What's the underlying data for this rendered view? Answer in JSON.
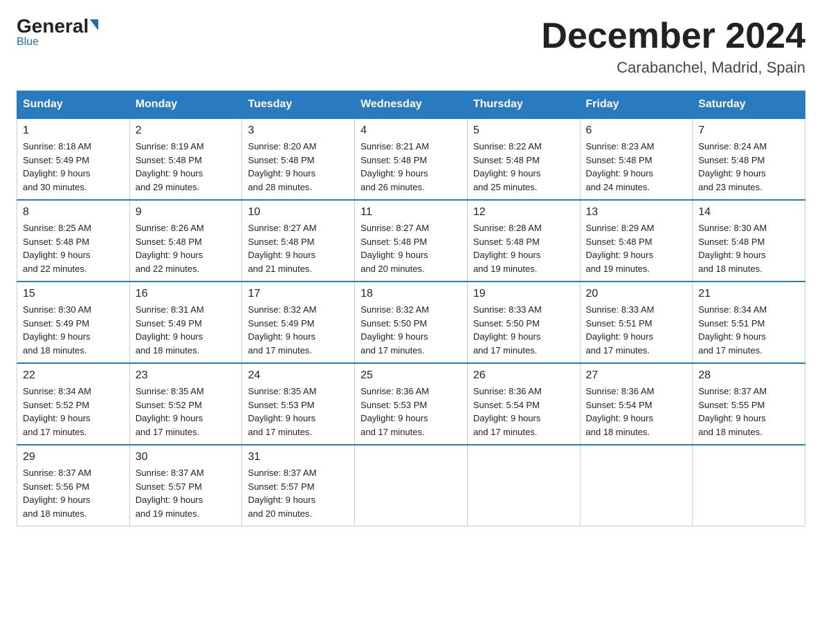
{
  "logo": {
    "general": "General",
    "blue": "Blue"
  },
  "title": "December 2024",
  "subtitle": "Carabanchel, Madrid, Spain",
  "headers": [
    "Sunday",
    "Monday",
    "Tuesday",
    "Wednesday",
    "Thursday",
    "Friday",
    "Saturday"
  ],
  "weeks": [
    [
      {
        "day": "1",
        "sunrise": "8:18 AM",
        "sunset": "5:49 PM",
        "daylight": "9 hours and 30 minutes."
      },
      {
        "day": "2",
        "sunrise": "8:19 AM",
        "sunset": "5:48 PM",
        "daylight": "9 hours and 29 minutes."
      },
      {
        "day": "3",
        "sunrise": "8:20 AM",
        "sunset": "5:48 PM",
        "daylight": "9 hours and 28 minutes."
      },
      {
        "day": "4",
        "sunrise": "8:21 AM",
        "sunset": "5:48 PM",
        "daylight": "9 hours and 26 minutes."
      },
      {
        "day": "5",
        "sunrise": "8:22 AM",
        "sunset": "5:48 PM",
        "daylight": "9 hours and 25 minutes."
      },
      {
        "day": "6",
        "sunrise": "8:23 AM",
        "sunset": "5:48 PM",
        "daylight": "9 hours and 24 minutes."
      },
      {
        "day": "7",
        "sunrise": "8:24 AM",
        "sunset": "5:48 PM",
        "daylight": "9 hours and 23 minutes."
      }
    ],
    [
      {
        "day": "8",
        "sunrise": "8:25 AM",
        "sunset": "5:48 PM",
        "daylight": "9 hours and 22 minutes."
      },
      {
        "day": "9",
        "sunrise": "8:26 AM",
        "sunset": "5:48 PM",
        "daylight": "9 hours and 22 minutes."
      },
      {
        "day": "10",
        "sunrise": "8:27 AM",
        "sunset": "5:48 PM",
        "daylight": "9 hours and 21 minutes."
      },
      {
        "day": "11",
        "sunrise": "8:27 AM",
        "sunset": "5:48 PM",
        "daylight": "9 hours and 20 minutes."
      },
      {
        "day": "12",
        "sunrise": "8:28 AM",
        "sunset": "5:48 PM",
        "daylight": "9 hours and 19 minutes."
      },
      {
        "day": "13",
        "sunrise": "8:29 AM",
        "sunset": "5:48 PM",
        "daylight": "9 hours and 19 minutes."
      },
      {
        "day": "14",
        "sunrise": "8:30 AM",
        "sunset": "5:48 PM",
        "daylight": "9 hours and 18 minutes."
      }
    ],
    [
      {
        "day": "15",
        "sunrise": "8:30 AM",
        "sunset": "5:49 PM",
        "daylight": "9 hours and 18 minutes."
      },
      {
        "day": "16",
        "sunrise": "8:31 AM",
        "sunset": "5:49 PM",
        "daylight": "9 hours and 18 minutes."
      },
      {
        "day": "17",
        "sunrise": "8:32 AM",
        "sunset": "5:49 PM",
        "daylight": "9 hours and 17 minutes."
      },
      {
        "day": "18",
        "sunrise": "8:32 AM",
        "sunset": "5:50 PM",
        "daylight": "9 hours and 17 minutes."
      },
      {
        "day": "19",
        "sunrise": "8:33 AM",
        "sunset": "5:50 PM",
        "daylight": "9 hours and 17 minutes."
      },
      {
        "day": "20",
        "sunrise": "8:33 AM",
        "sunset": "5:51 PM",
        "daylight": "9 hours and 17 minutes."
      },
      {
        "day": "21",
        "sunrise": "8:34 AM",
        "sunset": "5:51 PM",
        "daylight": "9 hours and 17 minutes."
      }
    ],
    [
      {
        "day": "22",
        "sunrise": "8:34 AM",
        "sunset": "5:52 PM",
        "daylight": "9 hours and 17 minutes."
      },
      {
        "day": "23",
        "sunrise": "8:35 AM",
        "sunset": "5:52 PM",
        "daylight": "9 hours and 17 minutes."
      },
      {
        "day": "24",
        "sunrise": "8:35 AM",
        "sunset": "5:53 PM",
        "daylight": "9 hours and 17 minutes."
      },
      {
        "day": "25",
        "sunrise": "8:36 AM",
        "sunset": "5:53 PM",
        "daylight": "9 hours and 17 minutes."
      },
      {
        "day": "26",
        "sunrise": "8:36 AM",
        "sunset": "5:54 PM",
        "daylight": "9 hours and 17 minutes."
      },
      {
        "day": "27",
        "sunrise": "8:36 AM",
        "sunset": "5:54 PM",
        "daylight": "9 hours and 18 minutes."
      },
      {
        "day": "28",
        "sunrise": "8:37 AM",
        "sunset": "5:55 PM",
        "daylight": "9 hours and 18 minutes."
      }
    ],
    [
      {
        "day": "29",
        "sunrise": "8:37 AM",
        "sunset": "5:56 PM",
        "daylight": "9 hours and 18 minutes."
      },
      {
        "day": "30",
        "sunrise": "8:37 AM",
        "sunset": "5:57 PM",
        "daylight": "9 hours and 19 minutes."
      },
      {
        "day": "31",
        "sunrise": "8:37 AM",
        "sunset": "5:57 PM",
        "daylight": "9 hours and 20 minutes."
      },
      null,
      null,
      null,
      null
    ]
  ],
  "labels": {
    "sunrise": "Sunrise:",
    "sunset": "Sunset:",
    "daylight": "Daylight:"
  }
}
